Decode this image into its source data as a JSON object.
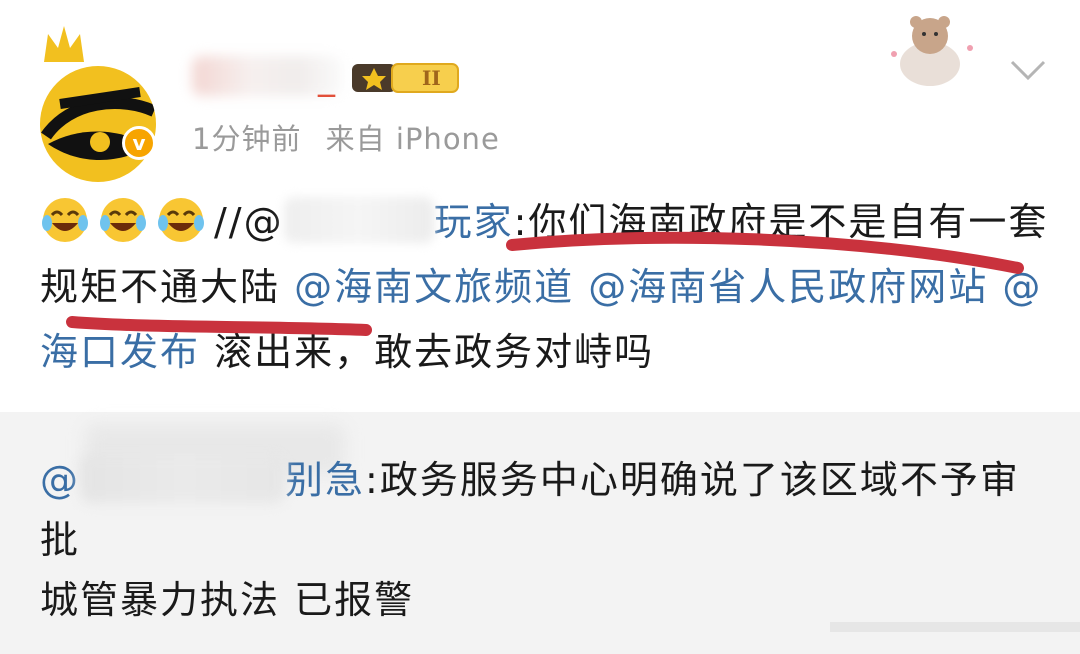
{
  "post": {
    "username_tail": "_",
    "level_badge": "II",
    "time": "1分钟前",
    "source": "来自 iPhone",
    "emojis": [
      "laugh-cry-emoji",
      "laugh-cry-emoji",
      "laugh-cry-emoji"
    ],
    "repost_prefix": "//@",
    "mention_suffix": "玩家",
    "quote": ":你们海南政府是不是自有一套规矩不通大陆 ",
    "mention1": "@海南文旅频道",
    "mention2": "@海南省人民政府网站",
    "mention3": "@海口发布",
    "tail": " 滚出来，敢去政务对峙吗"
  },
  "repost": {
    "at": "@",
    "name_suffix": "别急",
    "text_line1": ":政务服务中心明确说了该区域不予审批",
    "text_line2": "城管暴力执法 已报警"
  },
  "colors": {
    "mention": "#3a6ea5",
    "underline": "#c9323d",
    "badge": "#f2c01f"
  }
}
